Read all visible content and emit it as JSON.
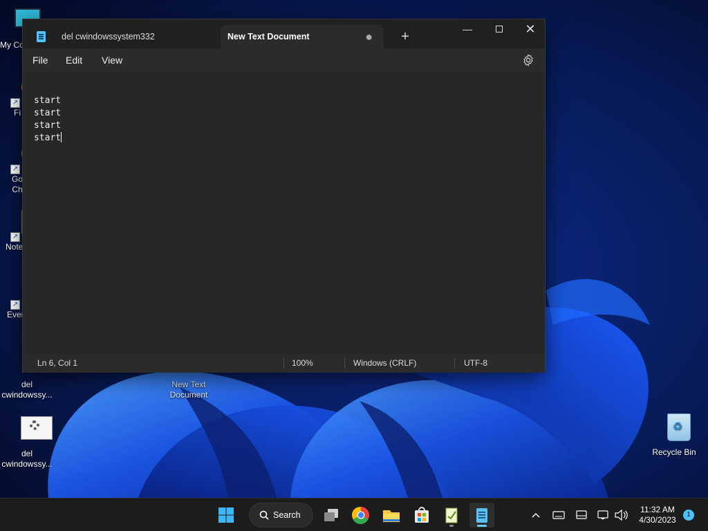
{
  "desktop": {
    "icons": [
      {
        "label": "My Co"
      },
      {
        "label": "Fi"
      },
      {
        "label": "Go\nCh"
      },
      {
        "label": "Note"
      },
      {
        "label": "Ever"
      },
      {
        "label": "del\ncwindowssy..."
      },
      {
        "label": "New Text\nDocument"
      },
      {
        "label": "del\ncwindowssy..."
      },
      {
        "label": "Recycle Bin"
      }
    ]
  },
  "notepad": {
    "tabs": [
      {
        "title": "del cwindowssystem332",
        "icon": "notepad-doc-icon"
      },
      {
        "title": "New Text Document",
        "unsaved_indicator": "●"
      }
    ],
    "new_tab_label": "+",
    "caption": {
      "minimize": "—",
      "close": "✕"
    },
    "menu": {
      "file": "File",
      "edit": "Edit",
      "view": "View"
    },
    "settings_icon": "gear-icon",
    "content_lines": [
      "",
      "start",
      "start",
      "start",
      "start"
    ],
    "status": {
      "position": "Ln 6, Col 1",
      "zoom": "100%",
      "line_endings": "Windows (CRLF)",
      "encoding": "UTF-8"
    }
  },
  "taskbar": {
    "search_label": "Search",
    "apps": [
      "start-icon",
      "task-view-icon",
      "chrome-icon",
      "file-explorer-icon",
      "store-icon",
      "notepad-plus-icon",
      "notepad-icon"
    ],
    "tray": {
      "time": "11:32 AM",
      "date": "4/30/2023",
      "notification_count": "1"
    }
  },
  "colors": {
    "window_bg": "#202020",
    "editor_bg": "#272727",
    "accent": "#60cdff"
  }
}
